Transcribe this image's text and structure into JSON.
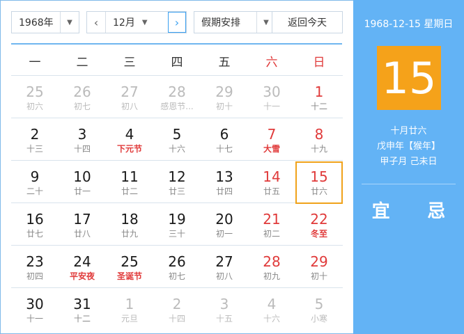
{
  "toolbar": {
    "year": "1968年",
    "month": "12月",
    "holiday": "假期安排",
    "today": "返回今天",
    "prev_icon": "chevron-left-icon",
    "next_icon": "chevron-right-icon",
    "dropdown_icon": "caret-down-icon"
  },
  "weekdays": [
    "一",
    "二",
    "三",
    "四",
    "五",
    "六",
    "日"
  ],
  "weeks": [
    [
      {
        "d": "25",
        "l": "初六",
        "other": true
      },
      {
        "d": "26",
        "l": "初七",
        "other": true
      },
      {
        "d": "27",
        "l": "初八",
        "other": true
      },
      {
        "d": "28",
        "l": "感恩节...",
        "other": true
      },
      {
        "d": "29",
        "l": "初十",
        "other": true
      },
      {
        "d": "30",
        "l": "十一",
        "other": true
      },
      {
        "d": "1",
        "l": "十二"
      }
    ],
    [
      {
        "d": "2",
        "l": "十三"
      },
      {
        "d": "3",
        "l": "十四"
      },
      {
        "d": "4",
        "l": "下元节",
        "fest": true
      },
      {
        "d": "5",
        "l": "十六"
      },
      {
        "d": "6",
        "l": "十七"
      },
      {
        "d": "7",
        "l": "大雪",
        "fest": true
      },
      {
        "d": "8",
        "l": "十九"
      }
    ],
    [
      {
        "d": "9",
        "l": "二十"
      },
      {
        "d": "10",
        "l": "廿一"
      },
      {
        "d": "11",
        "l": "廿二"
      },
      {
        "d": "12",
        "l": "廿三"
      },
      {
        "d": "13",
        "l": "廿四"
      },
      {
        "d": "14",
        "l": "廿五"
      },
      {
        "d": "15",
        "l": "廿六",
        "selected": true
      }
    ],
    [
      {
        "d": "16",
        "l": "廿七"
      },
      {
        "d": "17",
        "l": "廿八"
      },
      {
        "d": "18",
        "l": "廿九"
      },
      {
        "d": "19",
        "l": "三十"
      },
      {
        "d": "20",
        "l": "初一"
      },
      {
        "d": "21",
        "l": "初二"
      },
      {
        "d": "22",
        "l": "冬至",
        "fest": true
      }
    ],
    [
      {
        "d": "23",
        "l": "初四"
      },
      {
        "d": "24",
        "l": "平安夜",
        "fest": true
      },
      {
        "d": "25",
        "l": "圣诞节",
        "fest": true
      },
      {
        "d": "26",
        "l": "初七"
      },
      {
        "d": "27",
        "l": "初八"
      },
      {
        "d": "28",
        "l": "初九"
      },
      {
        "d": "29",
        "l": "初十"
      }
    ],
    [
      {
        "d": "30",
        "l": "十一"
      },
      {
        "d": "31",
        "l": "十二"
      },
      {
        "d": "1",
        "l": "元旦",
        "other": true
      },
      {
        "d": "2",
        "l": "十四",
        "other": true
      },
      {
        "d": "3",
        "l": "十五",
        "other": true
      },
      {
        "d": "4",
        "l": "十六",
        "other": true
      },
      {
        "d": "5",
        "l": "小寒",
        "other": true
      }
    ]
  ],
  "panel": {
    "date_line": "1968-12-15 星期日",
    "day": "15",
    "lunar_line1": "十月廿六",
    "lunar_line2": "戊申年【猴年】",
    "lunar_line3": "甲子月 己未日",
    "yi": "宜",
    "ji": "忌"
  },
  "colors": {
    "accent": "#3aa0f0",
    "panel_bg": "#63b3f5",
    "highlight": "#f5a21a",
    "weekend_red": "#e03a3a"
  }
}
